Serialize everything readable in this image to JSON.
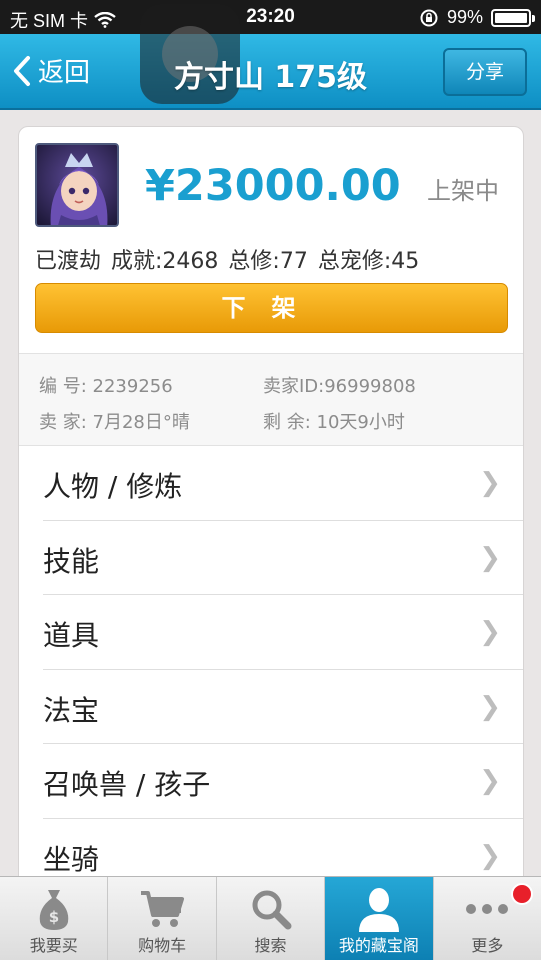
{
  "status_bar": {
    "carrier": "无 SIM 卡",
    "time": "23:20",
    "battery": "99%",
    "battery_level": 0.99
  },
  "nav": {
    "back_label": "返回",
    "title": "方寸山 175级",
    "share_label": "分享"
  },
  "item": {
    "price": "¥23000.00",
    "status": "上架中",
    "stats": [
      "已渡劫",
      "成就:2468",
      "总修:77",
      "总宠修:45"
    ],
    "takedown_label": "下架",
    "info": {
      "id_label": "编  号:",
      "id_value": "2239256",
      "seller_id_label": "卖家ID:",
      "seller_id_value": "96999808",
      "seller_label": "卖  家:",
      "seller_value": "7月28日°晴",
      "remaining_label": "剩  余:",
      "remaining_value": "10天9小时"
    }
  },
  "menu": {
    "items": [
      {
        "label": "人物 / 修炼"
      },
      {
        "label": "技能"
      },
      {
        "label": "道具"
      },
      {
        "label": "法宝"
      },
      {
        "label": "召唤兽 / 孩子"
      },
      {
        "label": "坐骑"
      }
    ]
  },
  "tabs": [
    {
      "label": "我要买",
      "icon": "money-bag-icon"
    },
    {
      "label": "购物车",
      "icon": "cart-icon"
    },
    {
      "label": "搜索",
      "icon": "search-icon"
    },
    {
      "label": "我的藏宝阁",
      "icon": "user-icon",
      "active": true
    },
    {
      "label": "更多",
      "icon": "more-icon",
      "badge": true
    }
  ],
  "colors": {
    "nav_blue": "#1a9fd0",
    "price_blue": "#1a9fd0",
    "button_orange": "#f2a61b",
    "badge_red": "#e8202a"
  }
}
